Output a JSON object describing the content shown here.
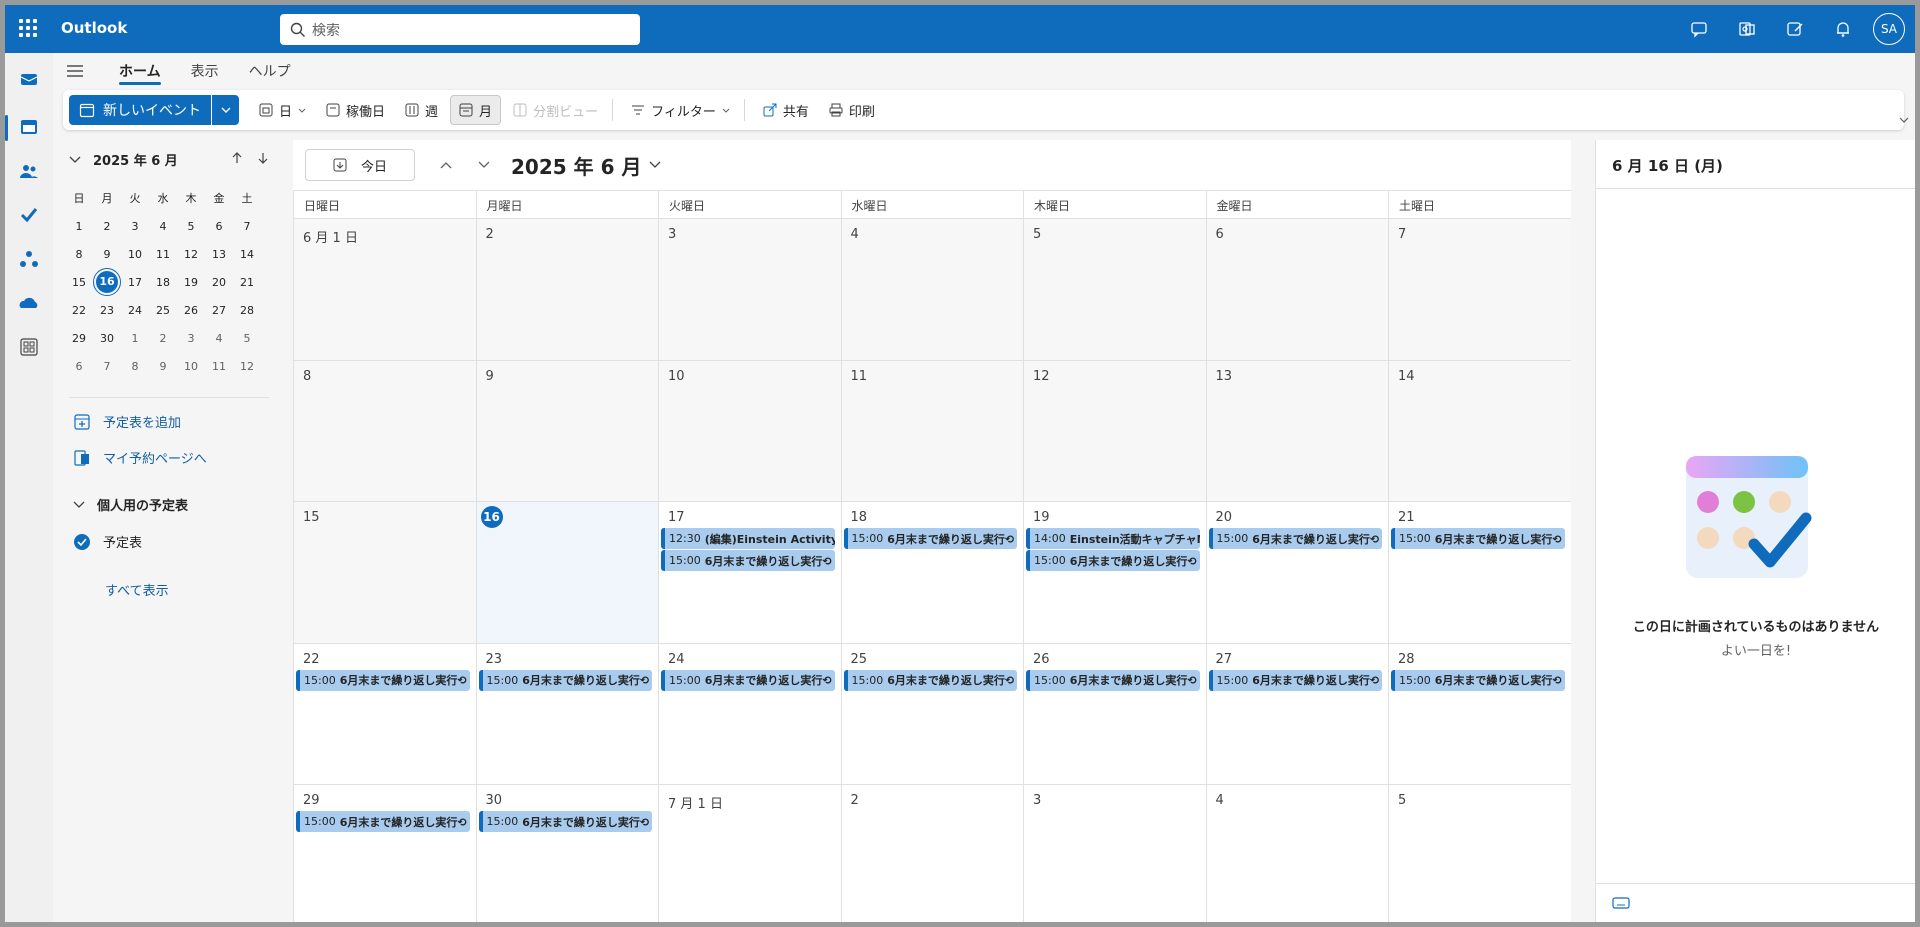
{
  "app": {
    "name": "Outlook",
    "avatar": "SA"
  },
  "search": {
    "placeholder": "検索"
  },
  "ribbon_tabs": [
    "ホーム",
    "表示",
    "ヘルプ"
  ],
  "toolbar": {
    "new_event": "新しいイベント",
    "day": "日",
    "workweek": "稼働日",
    "week": "週",
    "month": "月",
    "split": "分割ビュー",
    "filter": "フィルター",
    "share": "共有",
    "print": "印刷"
  },
  "mini_cal": {
    "title": "2025 年 6 月",
    "weekdays": [
      "日",
      "月",
      "火",
      "水",
      "木",
      "金",
      "土"
    ],
    "weeks": [
      [
        "1",
        "2",
        "3",
        "4",
        "5",
        "6",
        "7"
      ],
      [
        "8",
        "9",
        "10",
        "11",
        "12",
        "13",
        "14"
      ],
      [
        "15",
        "16",
        "17",
        "18",
        "19",
        "20",
        "21"
      ],
      [
        "22",
        "23",
        "24",
        "25",
        "26",
        "27",
        "28"
      ],
      [
        "29",
        "30",
        "1",
        "2",
        "3",
        "4",
        "5"
      ],
      [
        "6",
        "7",
        "8",
        "9",
        "10",
        "11",
        "12"
      ]
    ],
    "today": "16"
  },
  "sidebar": {
    "add_calendar": "予定表を追加",
    "booking": "マイ予約ページへ",
    "group_title": "個人用の予定表",
    "calendar_item": "予定表",
    "show_all": "すべて表示"
  },
  "calendar": {
    "today_button": "今日",
    "month_title": "2025 年 6 月",
    "weekdays": [
      "日曜日",
      "月曜日",
      "火曜日",
      "水曜日",
      "木曜日",
      "金曜日",
      "土曜日"
    ],
    "weeks": [
      [
        {
          "d": "6 月 1 日",
          "past": true
        },
        {
          "d": "2",
          "past": true
        },
        {
          "d": "3",
          "past": true
        },
        {
          "d": "4",
          "past": true
        },
        {
          "d": "5",
          "past": true
        },
        {
          "d": "6",
          "past": true
        },
        {
          "d": "7",
          "past": true
        }
      ],
      [
        {
          "d": "8",
          "past": true
        },
        {
          "d": "9",
          "past": true
        },
        {
          "d": "10",
          "past": true
        },
        {
          "d": "11",
          "past": true
        },
        {
          "d": "12",
          "past": true
        },
        {
          "d": "13",
          "past": true
        },
        {
          "d": "14",
          "past": true
        }
      ],
      [
        {
          "d": "15",
          "past": true
        },
        {
          "d": "16",
          "today": true
        },
        {
          "d": "17",
          "events": [
            {
              "time": "12:30",
              "title": "(編集)Einstein Activity C"
            },
            {
              "time": "15:00",
              "title": "6月末まで繰り返し実行⟲"
            }
          ]
        },
        {
          "d": "18",
          "events": [
            {
              "time": "15:00",
              "title": "6月末まで繰り返し実行⟲"
            }
          ]
        },
        {
          "d": "19",
          "events": [
            {
              "time": "14:00",
              "title": "Einstein活動キャプチャMS"
            },
            {
              "time": "15:00",
              "title": "6月末まで繰り返し実行⟲"
            }
          ]
        },
        {
          "d": "20",
          "events": [
            {
              "time": "15:00",
              "title": "6月末まで繰り返し実行⟲"
            }
          ]
        },
        {
          "d": "21",
          "events": [
            {
              "time": "15:00",
              "title": "6月末まで繰り返し実行⟲"
            }
          ]
        }
      ],
      [
        {
          "d": "22",
          "events": [
            {
              "time": "15:00",
              "title": "6月末まで繰り返し実行⟲"
            }
          ]
        },
        {
          "d": "23",
          "events": [
            {
              "time": "15:00",
              "title": "6月末まで繰り返し実行⟲"
            }
          ]
        },
        {
          "d": "24",
          "events": [
            {
              "time": "15:00",
              "title": "6月末まで繰り返し実行⟲"
            }
          ]
        },
        {
          "d": "25",
          "events": [
            {
              "time": "15:00",
              "title": "6月末まで繰り返し実行⟲"
            }
          ]
        },
        {
          "d": "26",
          "events": [
            {
              "time": "15:00",
              "title": "6月末まで繰り返し実行⟲"
            }
          ]
        },
        {
          "d": "27",
          "events": [
            {
              "time": "15:00",
              "title": "6月末まで繰り返し実行⟲"
            }
          ]
        },
        {
          "d": "28",
          "events": [
            {
              "time": "15:00",
              "title": "6月末まで繰り返し実行⟲"
            }
          ]
        }
      ],
      [
        {
          "d": "29",
          "events": [
            {
              "time": "15:00",
              "title": "6月末まで繰り返し実行⟲"
            }
          ]
        },
        {
          "d": "30",
          "events": [
            {
              "time": "15:00",
              "title": "6月末まで繰り返し実行⟲"
            }
          ]
        },
        {
          "d": "7 月 1 日"
        },
        {
          "d": "2"
        },
        {
          "d": "3"
        },
        {
          "d": "4"
        },
        {
          "d": "5"
        }
      ]
    ]
  },
  "pane": {
    "title": "6 月 16 日 (月)",
    "empty_title": "この日に計画されているものはありません",
    "empty_sub": "よい一日を!"
  },
  "colors": {
    "accent": "#0f6cbd",
    "event_bg": "#a9ccee"
  }
}
